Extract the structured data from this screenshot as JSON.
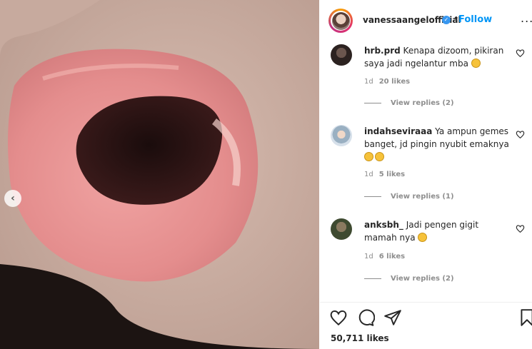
{
  "post": {
    "username": "vanessaangelofficial",
    "dot": "•",
    "follow_label": "Follow",
    "more_label": "...",
    "prev_label": "‹",
    "likes_total": "50,711 likes"
  },
  "comments": [
    {
      "username": "hrb.prd",
      "text": "Kenapa dizoom, pikiran saya jadi ngelantur mba",
      "emoji_count": 1,
      "age": "1d",
      "likes": "20 likes",
      "replies": "View replies (2)",
      "avatar_color": "#3a2e2a"
    },
    {
      "username": "indahseviraaa",
      "text": "Ya ampun gemes banget, jd pingin nyubit emaknya",
      "emoji_count": 2,
      "age": "1d",
      "likes": "5 likes",
      "replies": "View replies (1)",
      "avatar_color": "#b8c8d6"
    },
    {
      "username": "anksbh_",
      "text": "Jadi pengen gigit mamah nya",
      "emoji_count": 1,
      "age": "1d",
      "likes": "6 likes",
      "replies": "View replies (2)",
      "avatar_color": "#5a6a48"
    }
  ],
  "colors": {
    "accent": "#0095f6",
    "verified": "#3897f0",
    "muted": "#8e8e8e",
    "text": "#262626"
  },
  "icons": [
    "heart-icon",
    "comment-icon",
    "share-icon",
    "bookmark-icon",
    "verified-icon",
    "chevron-left-icon"
  ]
}
